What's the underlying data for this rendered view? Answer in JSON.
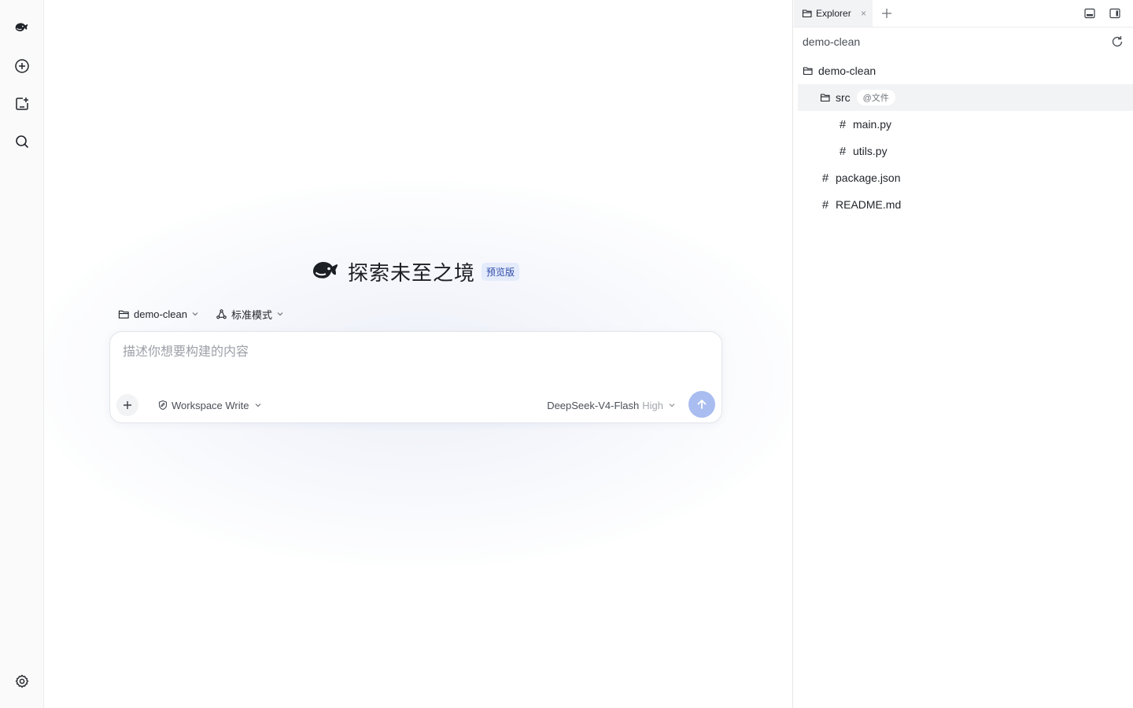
{
  "rail": {
    "items": [
      {
        "icon": "deepseek-whale-logo"
      },
      {
        "icon": "new-chat-icon"
      },
      {
        "icon": "new-project-icon"
      },
      {
        "icon": "search-icon"
      },
      {
        "icon": "settings-icon"
      }
    ]
  },
  "hero": {
    "title": "探索未至之境",
    "badge": "预览版"
  },
  "selectors": {
    "workspace": "demo-clean",
    "mode": "标准模式"
  },
  "composer": {
    "placeholder": "描述你想要构建的内容",
    "permission": "Workspace Write",
    "model_name": "DeepSeek-V4-Flash",
    "model_effort": "High"
  },
  "panel": {
    "tab_label": "Explorer",
    "tab_close": "×",
    "workspace_name": "demo-clean",
    "tree": [
      {
        "label": "demo-clean",
        "type": "folder"
      },
      {
        "label": "src",
        "type": "folder",
        "tag": "@文件"
      },
      {
        "label": "main.py",
        "type": "file"
      },
      {
        "label": "utils.py",
        "type": "file"
      },
      {
        "label": "package.json",
        "type": "file"
      },
      {
        "label": "README.md",
        "type": "file"
      }
    ],
    "file_glyph": "#"
  },
  "colors": {
    "accent": "#a9bdf0",
    "badge_bg": "#e4ebfb",
    "badge_text": "#2f4ba8",
    "selected_row": "#f2f3f5"
  }
}
